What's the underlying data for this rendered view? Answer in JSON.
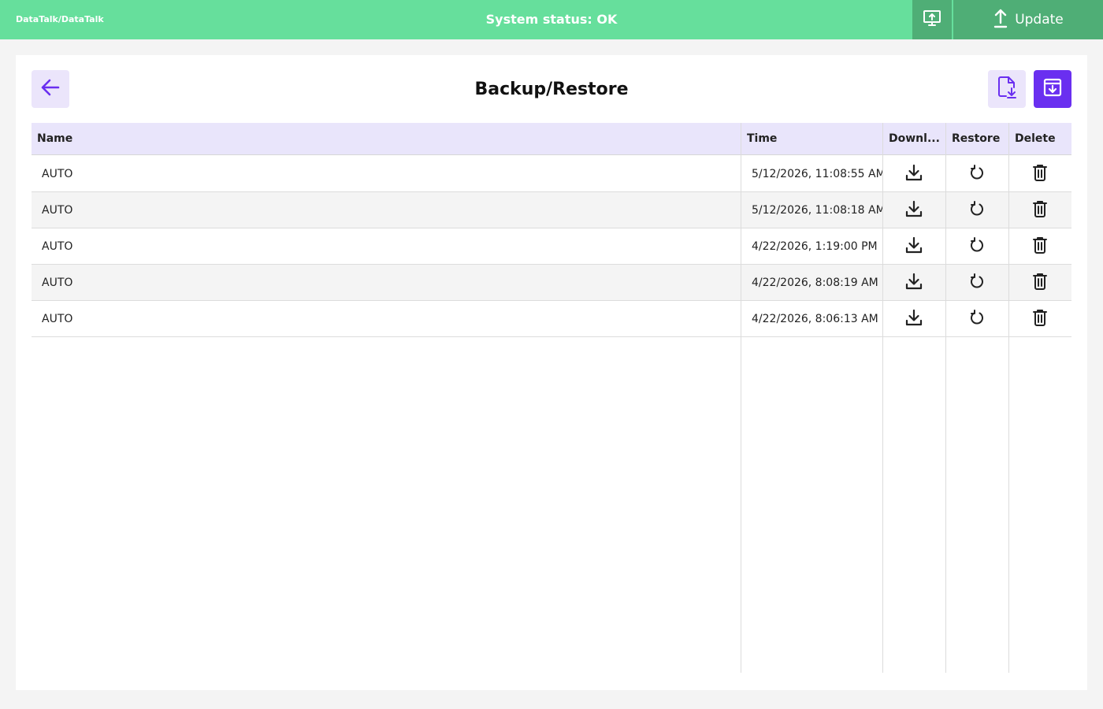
{
  "header": {
    "breadcrumb": "DataTalk/DataTalk",
    "status": "System status: OK",
    "screen_icon": "screen-upload-icon",
    "update_label": "Update",
    "update_icon": "upload-arrow-icon"
  },
  "page": {
    "title": "Backup/Restore",
    "back_icon": "arrow-left-icon",
    "file_download_icon": "file-download-icon",
    "archive_icon": "archive-download-icon"
  },
  "table": {
    "columns": [
      "Name",
      "Time",
      "Downl...",
      "Restore",
      "Delete"
    ],
    "rows": [
      {
        "name": "AUTO",
        "time": "5/12/2026, 11:08:55 AM"
      },
      {
        "name": "AUTO",
        "time": "5/12/2026, 11:08:18 AM"
      },
      {
        "name": "AUTO",
        "time": "4/22/2026, 1:19:00 PM"
      },
      {
        "name": "AUTO",
        "time": "4/22/2026, 8:08:19 AM"
      },
      {
        "name": "AUTO",
        "time": "4/22/2026, 8:06:13 AM"
      }
    ],
    "row_icons": [
      "download-icon",
      "restore-icon",
      "trash-icon"
    ]
  },
  "colors": {
    "header_bg": "#66df9c",
    "header_button_bg": "#4fae76",
    "accent": "#6a2ff0",
    "accent_light": "#ebe5fb",
    "table_header_bg": "#e9e5fb"
  }
}
